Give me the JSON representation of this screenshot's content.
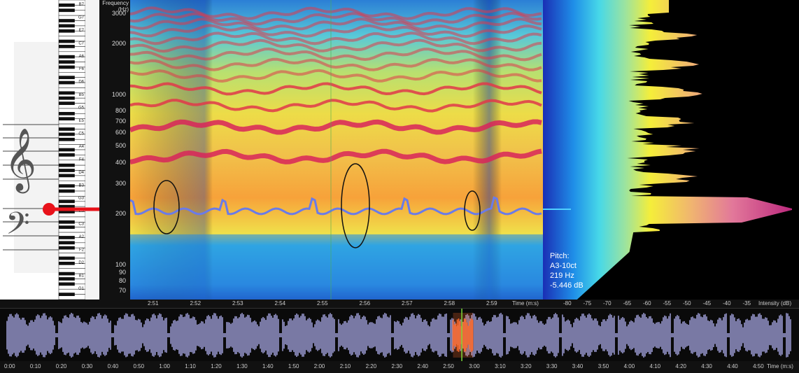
{
  "frequency_axis": {
    "title_line1": "Frequency",
    "title_line2": "(Hz)",
    "ticks": [
      "3000",
      "2000",
      "1000",
      "800",
      "700",
      "600",
      "500",
      "400",
      "300",
      "200",
      "100",
      "90",
      "80",
      "70"
    ]
  },
  "time_axis": {
    "ticks": [
      "2:51",
      "2:52",
      "2:53",
      "2:54",
      "2:55",
      "2:56",
      "2:57",
      "2:58",
      "2:59"
    ],
    "unit_label": "Time (m:s)"
  },
  "intensity_axis": {
    "ticks": [
      "-80",
      "-75",
      "-70",
      "-65",
      "-60",
      "-55",
      "-50",
      "-45",
      "-40",
      "-35"
    ],
    "unit_label": "Intensity (dB)"
  },
  "overview_timeline": {
    "ticks": [
      "0:00",
      "0:10",
      "0:20",
      "0:30",
      "0:40",
      "0:50",
      "1:00",
      "1:10",
      "1:20",
      "1:30",
      "1:40",
      "1:50",
      "2:00",
      "2:10",
      "2:20",
      "2:30",
      "2:40",
      "2:50",
      "3:00",
      "3:10",
      "3:20",
      "3:30",
      "3:40",
      "3:50",
      "4:00",
      "4:10",
      "4:20",
      "4:30",
      "4:40",
      "4:50"
    ],
    "unit_label": "Time (m:s)",
    "selection_fraction": [
      0.567,
      0.592
    ],
    "cursor_fraction": 0.578
  },
  "pitch": {
    "label": "Pitch:",
    "note": "A3-10ct",
    "frequency": "219 Hz",
    "level": "-5.446 dB"
  },
  "piano_keys": {
    "labels": [
      "B7",
      "G7",
      "E7",
      "C7",
      "A6",
      "F6",
      "D6",
      "B5",
      "G5",
      "E5",
      "C5",
      "A4",
      "F4",
      "D4",
      "B3",
      "G3",
      "E3",
      "C3",
      "A2",
      "F2",
      "D2",
      "B1",
      "G1"
    ],
    "marked_note": "A3"
  },
  "colors": {
    "spectro_low": "#1b2a8f",
    "spectro_mid": "#f5e94a",
    "spectro_high": "#d8245a",
    "pitch_track": "#6a7be8",
    "waveform": "#a9a9e6",
    "selection": "#ff6a2a",
    "marker": "#e8121a"
  }
}
